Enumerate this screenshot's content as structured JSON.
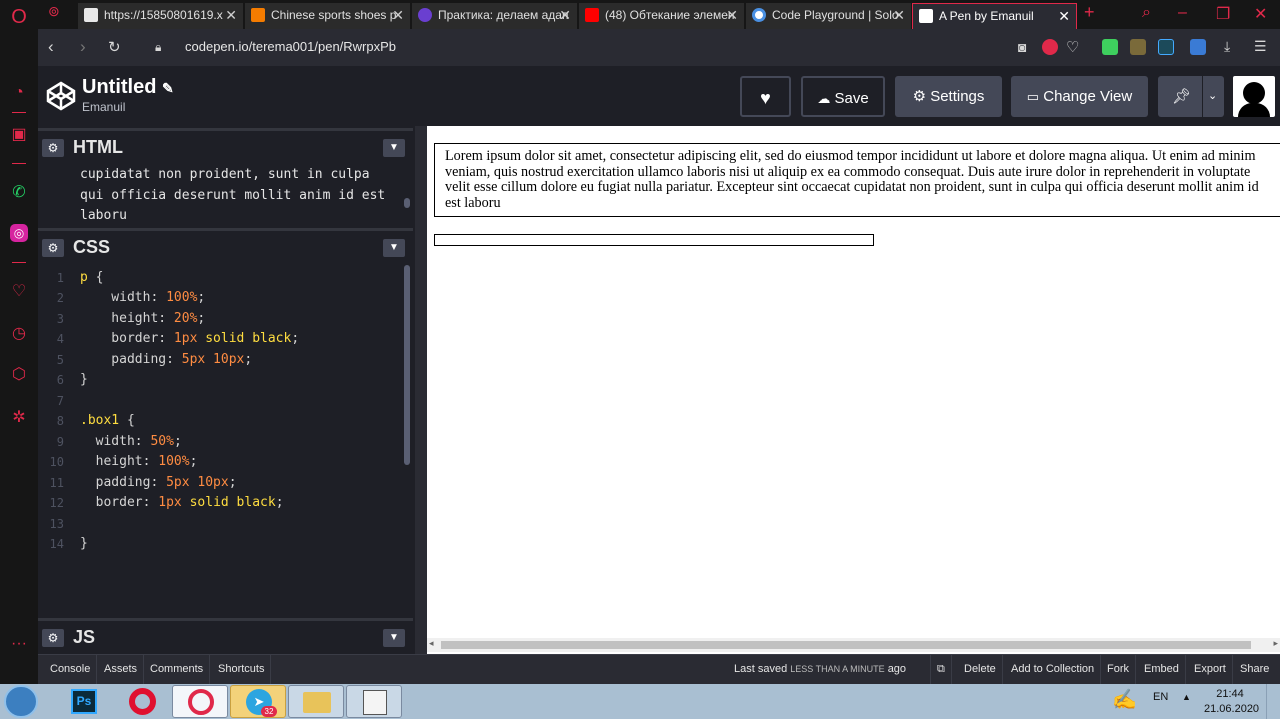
{
  "browser": {
    "tabs": [
      {
        "label": "https://15850801619.x",
        "color": "#e8e8e8"
      },
      {
        "label": "Chinese sports shoes p",
        "color": "#f57c00"
      },
      {
        "label": "Практика: делаем адап",
        "color": "#6a3fd0"
      },
      {
        "label": "(48) Обтекание элемен",
        "color": "#ff0000"
      },
      {
        "label": "Code Playground | Solo",
        "color": "#ffffff"
      },
      {
        "label": "A Pen by Emanuil",
        "color": "#ffffff"
      }
    ],
    "url": "codepen.io/terema001/pen/RwrpxPb"
  },
  "codepen": {
    "title": "Untitled",
    "user": "Emanuil",
    "buttons": {
      "save": "Save",
      "settings": "Settings",
      "change_view": "Change View"
    }
  },
  "editors": {
    "html": {
      "title": "HTML",
      "lines": [
        "cupidatat non proident, sunt in culpa",
        "qui officia deserunt mollit anim id est",
        "laboru"
      ]
    },
    "css": {
      "title": "CSS",
      "line_numbers": [
        "1",
        "2",
        "3",
        "4",
        "5",
        "6",
        "7",
        "8",
        "9",
        "10",
        "11",
        "12",
        "13",
        "14"
      ]
    },
    "js": {
      "title": "JS"
    }
  },
  "preview": {
    "paragraph": "Lorem ipsum dolor sit amet, consectetur adipiscing elit, sed do eiusmod tempor incididunt ut labore et dolore magna aliqua. Ut enim ad minim veniam, quis nostrud exercitation ullamco laboris nisi ut aliquip ex ea commodo consequat. Duis aute irure dolor in reprehenderit in voluptate velit esse cillum dolore eu fugiat nulla pariatur. Excepteur sint occaecat cupidatat non proident, sunt in culpa qui officia deserunt mollit anim id est laboru"
  },
  "footer": {
    "console": "Console",
    "assets": "Assets",
    "comments": "Comments",
    "shortcuts": "Shortcuts",
    "last_saved_label": "Last saved",
    "last_saved_value": "LESS THAN A MINUTE",
    "last_saved_suffix": "ago",
    "delete": "Delete",
    "add_to_collection": "Add to Collection",
    "fork": "Fork",
    "embed": "Embed",
    "export": "Export",
    "share": "Share"
  },
  "taskbar": {
    "lang": "EN",
    "time": "21:44",
    "date": "21.06.2020",
    "telegram_badge": "32"
  }
}
